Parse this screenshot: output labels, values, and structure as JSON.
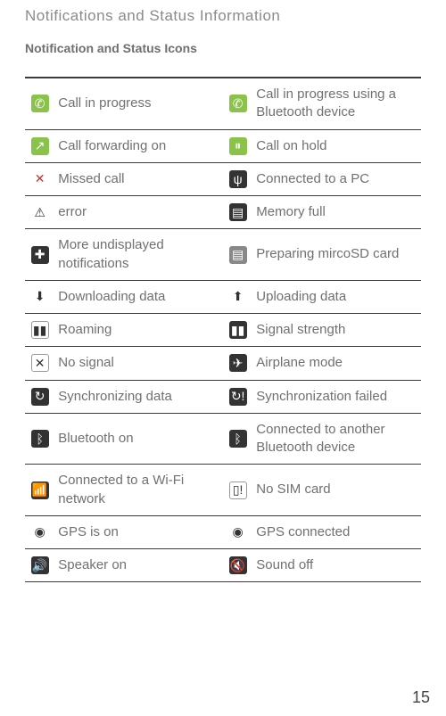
{
  "section_title": "Notifications and Status Information",
  "subsection_title": "Notification and Status Icons",
  "page_number": "15",
  "rows": [
    {
      "l_icon": "call-in-progress-icon",
      "l_glyph": "✆",
      "l_cls": "bg-green",
      "l_label": "Call in progress",
      "r_icon": "call-bluetooth-icon",
      "r_glyph": "✆",
      "r_cls": "bg-green",
      "r_label": "Call in progress using a Bluetooth device"
    },
    {
      "l_icon": "call-forwarding-icon",
      "l_glyph": "↗",
      "l_cls": "bg-green",
      "l_label": "Call forwarding on",
      "r_icon": "call-hold-icon",
      "r_glyph": "⏸",
      "r_cls": "bg-green",
      "r_label": "Call on hold"
    },
    {
      "l_icon": "missed-call-icon",
      "l_glyph": "✕",
      "l_cls": "red",
      "l_label": "Missed call",
      "r_icon": "connected-pc-icon",
      "r_glyph": "ψ",
      "r_cls": "bg-dark",
      "r_label": "Connected to a PC"
    },
    {
      "l_icon": "error-icon",
      "l_glyph": "⚠",
      "l_cls": "",
      "l_label": "error",
      "r_icon": "memory-full-icon",
      "r_glyph": "▤",
      "r_cls": "bg-dark",
      "r_label": "Memory full"
    },
    {
      "l_icon": "more-notifications-icon",
      "l_glyph": "✚",
      "l_cls": "bg-dark",
      "l_label": "More undisplayed notifications",
      "r_icon": "preparing-sd-icon",
      "r_glyph": "▤",
      "r_cls": "bg-gray",
      "r_label": "Preparing mircoSD card"
    },
    {
      "l_icon": "downloading-icon",
      "l_glyph": "⬇",
      "l_cls": "",
      "l_label": "Downloading data",
      "r_icon": "uploading-icon",
      "r_glyph": "⬆",
      "r_cls": "",
      "r_label": "Uploading data"
    },
    {
      "l_icon": "roaming-icon",
      "l_glyph": "▮▮",
      "l_cls": "bg-white-b",
      "l_label": "Roaming",
      "r_icon": "signal-strength-icon",
      "r_glyph": "▮▮",
      "r_cls": "bg-dark",
      "r_label": "Signal strength"
    },
    {
      "l_icon": "no-signal-icon",
      "l_glyph": "✕",
      "l_cls": "bg-white-b",
      "l_label": "No signal",
      "r_icon": "airplane-mode-icon",
      "r_glyph": "✈",
      "r_cls": "bg-dark",
      "r_label": "Airplane mode"
    },
    {
      "l_icon": "sync-icon",
      "l_glyph": "↻",
      "l_cls": "bg-dark",
      "l_label": "Synchronizing data",
      "r_icon": "sync-failed-icon",
      "r_glyph": "↻!",
      "r_cls": "bg-dark",
      "r_label": "Synchronization failed"
    },
    {
      "l_icon": "bluetooth-on-icon",
      "l_glyph": "ᛒ",
      "l_cls": "bg-dark",
      "l_label": "Bluetooth on",
      "r_icon": "bluetooth-connected-icon",
      "r_glyph": "ᛒ",
      "r_cls": "bg-dark",
      "r_label": "Connected to another Bluetooth device"
    },
    {
      "l_icon": "wifi-icon",
      "l_glyph": "📶",
      "l_cls": "bg-dark",
      "l_label": "Connected to a Wi-Fi network",
      "r_icon": "no-sim-icon",
      "r_glyph": "▯!",
      "r_cls": "bg-white-b",
      "r_label": "No SIM card"
    },
    {
      "l_icon": "gps-on-icon",
      "l_glyph": "◉",
      "l_cls": "",
      "l_label": "GPS is on",
      "r_icon": "gps-connected-icon",
      "r_glyph": "◉",
      "r_cls": "",
      "r_label": "GPS connected"
    },
    {
      "l_icon": "speaker-on-icon",
      "l_glyph": "🔊",
      "l_cls": "bg-dark",
      "l_label": "Speaker on",
      "r_icon": "sound-off-icon",
      "r_glyph": "🔇",
      "r_cls": "bg-dark",
      "r_label": "Sound off"
    }
  ]
}
